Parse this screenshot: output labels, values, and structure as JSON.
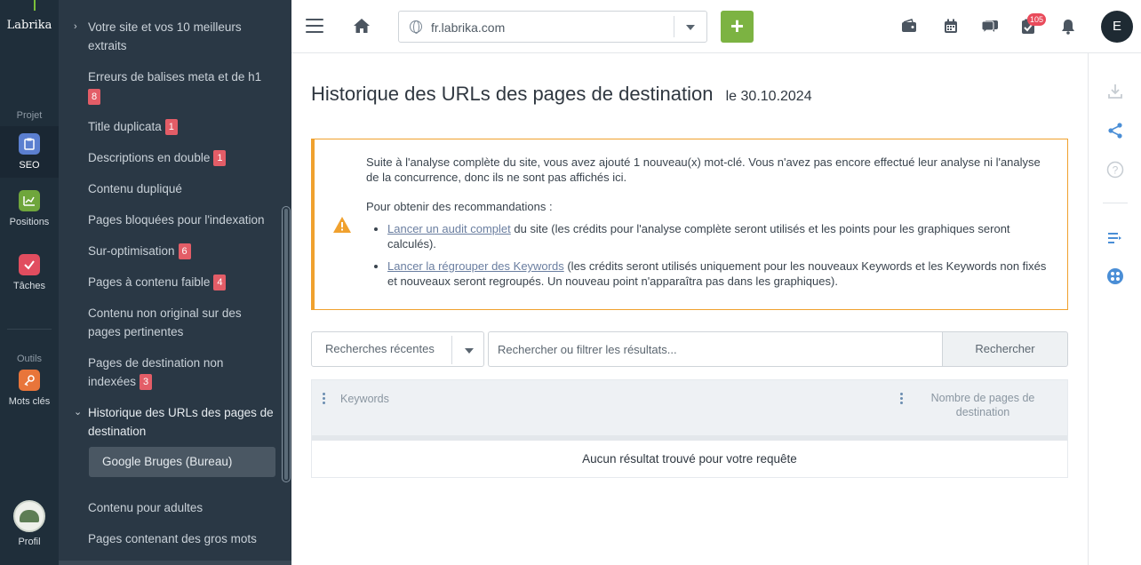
{
  "rail": {
    "logo": "Labrika",
    "section_project": "Projet",
    "section_tools": "Outils",
    "items": [
      {
        "label": "SEO",
        "color": "#5b7fd0"
      },
      {
        "label": "Positions",
        "color": "#6fa63c"
      },
      {
        "label": "Tâches",
        "color": "#e14d5f"
      },
      {
        "label": "Mots clés",
        "color": "#e8753a"
      }
    ],
    "profile": "Profil"
  },
  "submenu": {
    "items": [
      {
        "label": "Votre site et vos 10 meilleurs extraits"
      },
      {
        "label": "Erreurs de balises meta et de h1",
        "badge": "8"
      },
      {
        "label": "Title duplicata",
        "badge": "1"
      },
      {
        "label": "Descriptions en double",
        "badge": "1"
      },
      {
        "label": "Contenu dupliqué"
      },
      {
        "label": "Pages bloquées pour l'indexation"
      },
      {
        "label": "Sur-optimisation",
        "badge": "6"
      },
      {
        "label": "Pages à contenu faible",
        "badge": "4"
      },
      {
        "label": "Contenu non original sur des pages pertinentes"
      },
      {
        "label": "Pages de destination non indexées",
        "badge": "3"
      },
      {
        "label": "Historique des URLs des pages de destination"
      },
      {
        "label": "Contenu pour adultes"
      },
      {
        "label": "Pages contenant des gros mots"
      }
    ],
    "sub_item": "Google Bruges (Bureau)"
  },
  "topbar": {
    "url": "fr.labrika.com",
    "add_label": "+",
    "notifications_count": "105",
    "user_initial": "E"
  },
  "main": {
    "title": "Historique des URLs des pages de destination",
    "date": "le 30.10.2024",
    "alert": {
      "p1": "Suite à l'analyse complète du site, vous avez ajouté 1 nouveau(x) mot-clé. Vous n'avez pas encore effectué leur analyse ni l'analyse de la concurrence, donc ils ne sont pas affichés ici.",
      "p2": "Pour obtenir des recommandations :",
      "link1": "Lancer un audit complet",
      "text1": " du site (les crédits pour l'analyse complète seront utilisés et les points pour les graphiques seront calculés).",
      "link2": "Lancer la régrouper des Keywords",
      "text2": " (les crédits seront utilisés uniquement pour les nouveaux Keywords et les Keywords non fixés et nouveaux seront regroupés. Un nouveau point n'apparaîtra pas dans les graphiques)."
    },
    "recent_label": "Recherches récentes",
    "search_placeholder": "Rechercher ou filtrer les résultats...",
    "search_button": "Rechercher",
    "table": {
      "col_keywords": "Keywords",
      "col_pages": "Nombre de pages de destination",
      "empty": "Aucun résultat trouvé pour votre requête"
    }
  },
  "colors": {
    "accent_green": "#7cb342",
    "warning_orange": "#f0a12e",
    "badge_red": "#e35d67",
    "link_blue": "#5b8fd6"
  }
}
